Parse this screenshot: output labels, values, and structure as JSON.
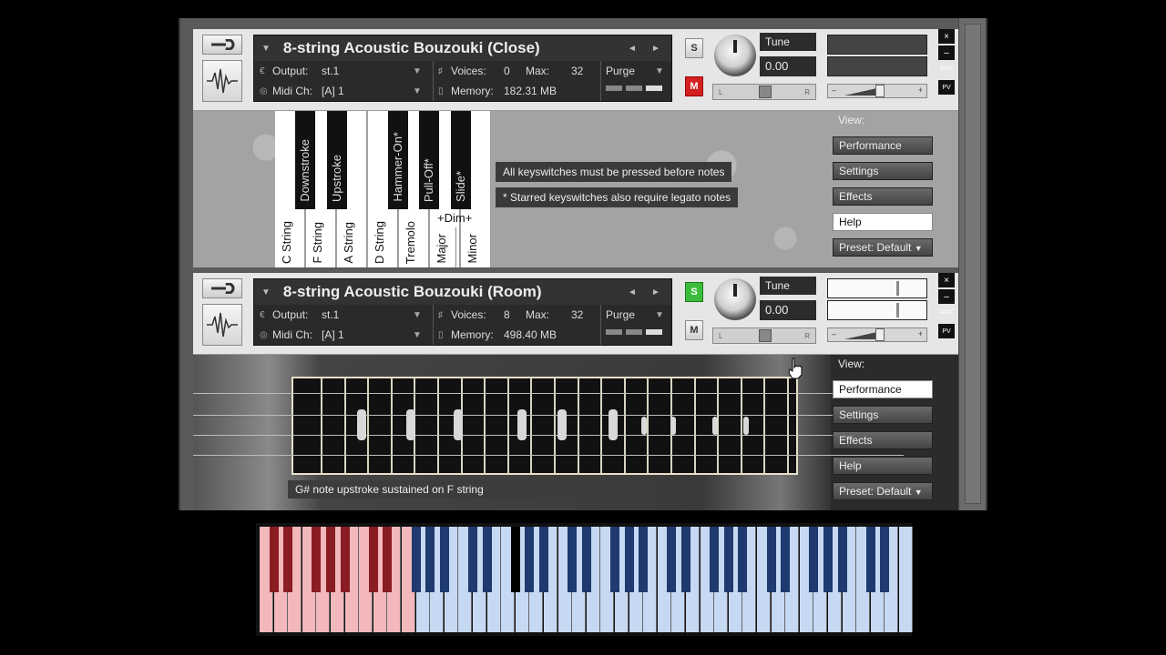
{
  "instruments": [
    {
      "name": "8-string Acoustic Bouzouki (Close)",
      "output_label": "Output:",
      "output_value": "st.1",
      "voices_label": "Voices:",
      "voices": "0",
      "max_label": "Max:",
      "max": "32",
      "purge": "Purge",
      "midi_label": "Midi Ch:",
      "midi_value": "[A]  1",
      "memory_label": "Memory:",
      "memory": "182.31 MB",
      "solo": "S",
      "mute": "M",
      "solo_active": false,
      "mute_active": true,
      "tune_label": "Tune",
      "tune_value": "0.00",
      "pan_left": "L",
      "pan_right": "R",
      "aux": "AUX",
      "pv": "PV",
      "close": "×",
      "minimize": "–",
      "vol_minus": "–",
      "vol_plus": "+"
    },
    {
      "name": "8-string Acoustic Bouzouki (Room)",
      "output_label": "Output:",
      "output_value": "st.1",
      "voices_label": "Voices:",
      "voices": "8",
      "max_label": "Max:",
      "max": "32",
      "purge": "Purge",
      "midi_label": "Midi Ch:",
      "midi_value": "[A]  1",
      "memory_label": "Memory:",
      "memory": "498.40 MB",
      "solo": "S",
      "mute": "M",
      "solo_active": true,
      "mute_active": false,
      "tune_label": "Tune",
      "tune_value": "0.00",
      "pan_left": "L",
      "pan_right": "R",
      "aux": "AUX",
      "pv": "PV",
      "close": "×",
      "minimize": "–",
      "vol_minus": "–",
      "vol_plus": "+"
    }
  ],
  "keyswitch_panel": {
    "white_keys": [
      "C String",
      "F String",
      "A String",
      "D String",
      "Tremolo",
      "Major",
      "Minor"
    ],
    "black_keys": [
      "Downstroke",
      "Upstroke",
      "Hammer-On*",
      "Pull-Off*",
      "Slide*"
    ],
    "dim_label": "+Dim+",
    "note1": "All keyswitches must be pressed before notes",
    "note2": "* Starred keyswitches also require legato notes"
  },
  "menu": {
    "view": "View:",
    "performance": "Performance",
    "settings": "Settings",
    "effects": "Effects",
    "help": "Help",
    "preset": "Preset: Default"
  },
  "menu1_active": "Help",
  "menu2_active": "Performance",
  "fretboard_status": "G# note upstroke sustained on F string",
  "colors": {
    "keyboard_red_zone": "#f2b8bc",
    "keyboard_red_black": "#8a1c24",
    "keyboard_blue_zone": "#c6d8f2",
    "keyboard_blue_black": "#1e3a6e",
    "mute_red": "#d42020",
    "solo_green": "#3cbc3c"
  }
}
